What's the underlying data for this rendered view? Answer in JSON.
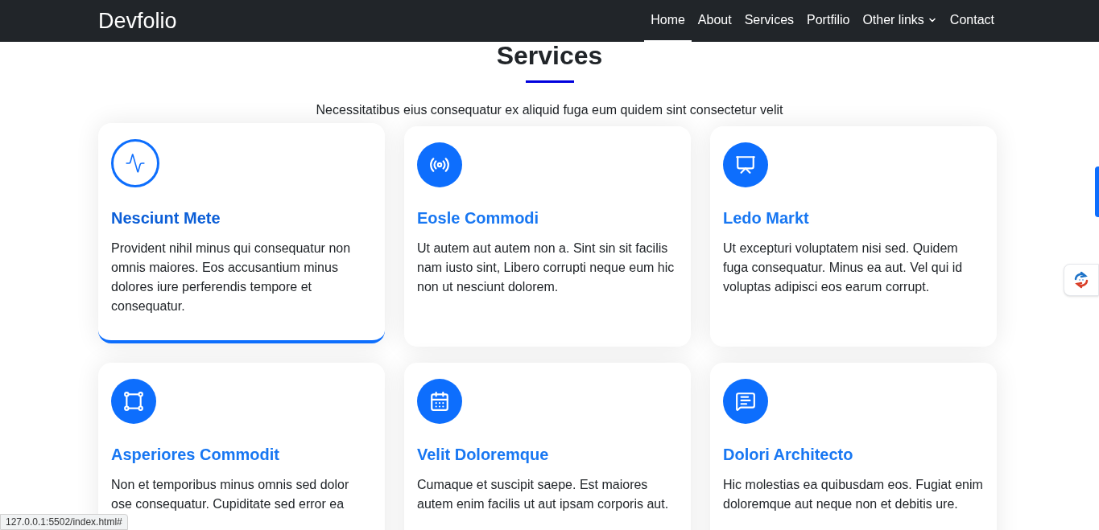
{
  "navbar": {
    "brand": "Devfolio",
    "links": [
      {
        "label": "Home",
        "selected": true,
        "kind": "link"
      },
      {
        "label": "About",
        "selected": false,
        "kind": "link"
      },
      {
        "label": "Services",
        "selected": false,
        "kind": "link"
      },
      {
        "label": "Portfilio",
        "selected": false,
        "kind": "link"
      },
      {
        "label": "Other links",
        "selected": false,
        "kind": "dropdown"
      },
      {
        "label": "Contact",
        "selected": false,
        "kind": "link"
      }
    ]
  },
  "section": {
    "title": "Services",
    "subtitle": "Necessitatibus eius consequatur ex aliquid fuga eum quidem sint consectetur velit"
  },
  "cards": [
    {
      "title": "Nesciunt Mete",
      "text": "Provident nihil minus qui consequatur non omnis maiores. Eos accusantium minus dolores iure perferendis tempore et consequatur.",
      "selected": true
    },
    {
      "title": "Eosle Commodi",
      "text": "Ut autem aut autem non a. Sint sin sit facilis nam iusto sint, Libero corrupti neque eum hic non ut nesciunt dolorem.",
      "selected": false
    },
    {
      "title": "Ledo Markt",
      "text": "Ut excepturi voluptatem nisi sed. Quidem fuga consequatur. Minus ea aut. Vel qui id voluptas adipisci eos earum corrupt.",
      "selected": false
    },
    {
      "title": "Asperiores Commodit",
      "text": "Non et temporibus minus omnis sed dolor ose consequatur. Cupiditate sed error ea",
      "selected": false
    },
    {
      "title": "Velit Doloremque",
      "text": "Cumaque et suscipit saepe. Est maiores autem enim facilis ut aut ipsam corporis aut.",
      "selected": false
    },
    {
      "title": "Dolori Architecto",
      "text": "Hic molestias ea quibusdam eos. Fugiat enim doloremque aut neque non et debitis ure.",
      "selected": false
    }
  ],
  "status_bar": {
    "url": "127.0.0.1:5502/index.html#"
  }
}
